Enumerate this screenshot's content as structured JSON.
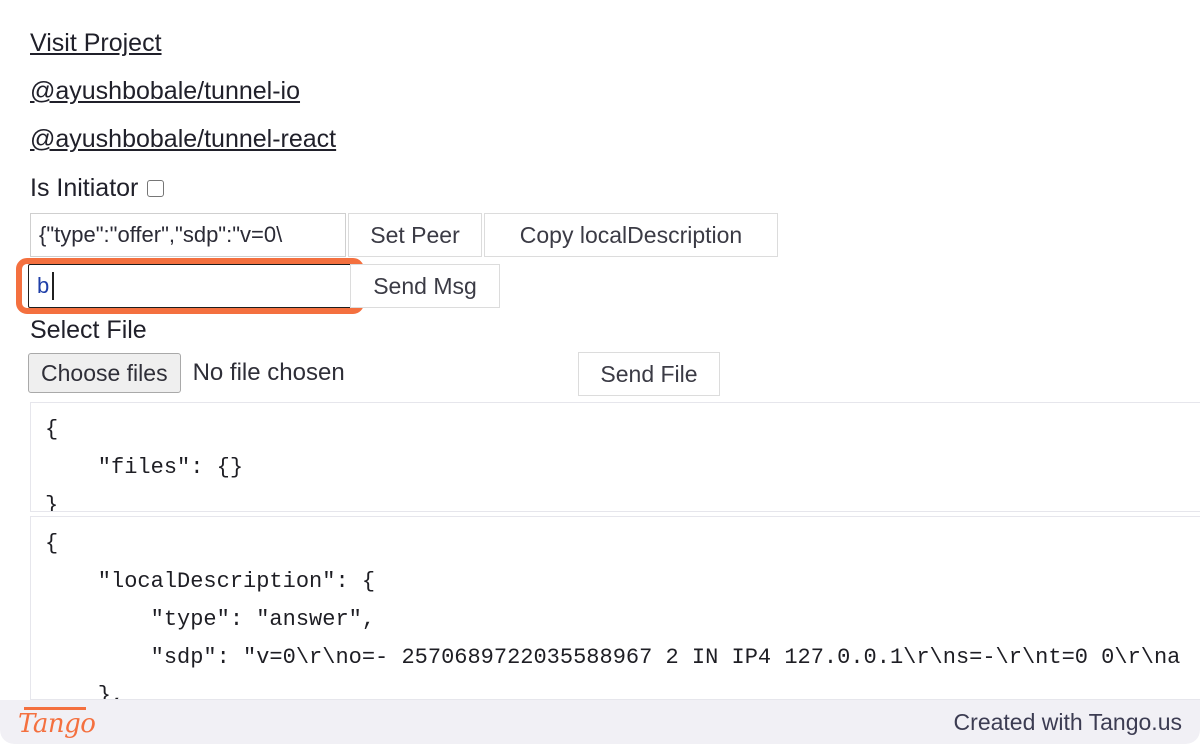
{
  "links": [
    {
      "label": "Visit Project"
    },
    {
      "label": "@ayushbobale/tunnel-io"
    },
    {
      "label": "@ayushbobale/tunnel-react"
    }
  ],
  "initiator": {
    "label": "Is Initiator",
    "checked": false
  },
  "peer_row": {
    "offer_input_value": "{\"type\":\"offer\",\"sdp\":\"v=0\\",
    "offer_input_placeholder": "",
    "set_peer_label": "Set Peer",
    "copy_local_description_label": "Copy localDescription"
  },
  "message_row": {
    "message_input_value": "b",
    "message_input_placeholder": "",
    "send_msg_label": "Send Msg",
    "highlight_color": "#F4703F"
  },
  "file_row": {
    "select_file_label": "Select File",
    "choose_files_label": "Choose files",
    "no_file_chosen_text": "No file chosen",
    "send_file_label": "Send File"
  },
  "code_blocks": {
    "files_json": "{\n    \"files\": {}\n}",
    "local_description_json": "{\n    \"localDescription\": {\n        \"type\": \"answer\",\n        \"sdp\": \"v=0\\r\\no=- 2570689722035588967 2 IN IP4 127.0.0.1\\r\\ns=-\\r\\nt=0 0\\r\\na\n    },"
  },
  "footer": {
    "logo_text": "Tango",
    "credit_text": "Created with Tango.us",
    "logo_color": "#F4703F",
    "background_color": "#F1F0F5"
  }
}
